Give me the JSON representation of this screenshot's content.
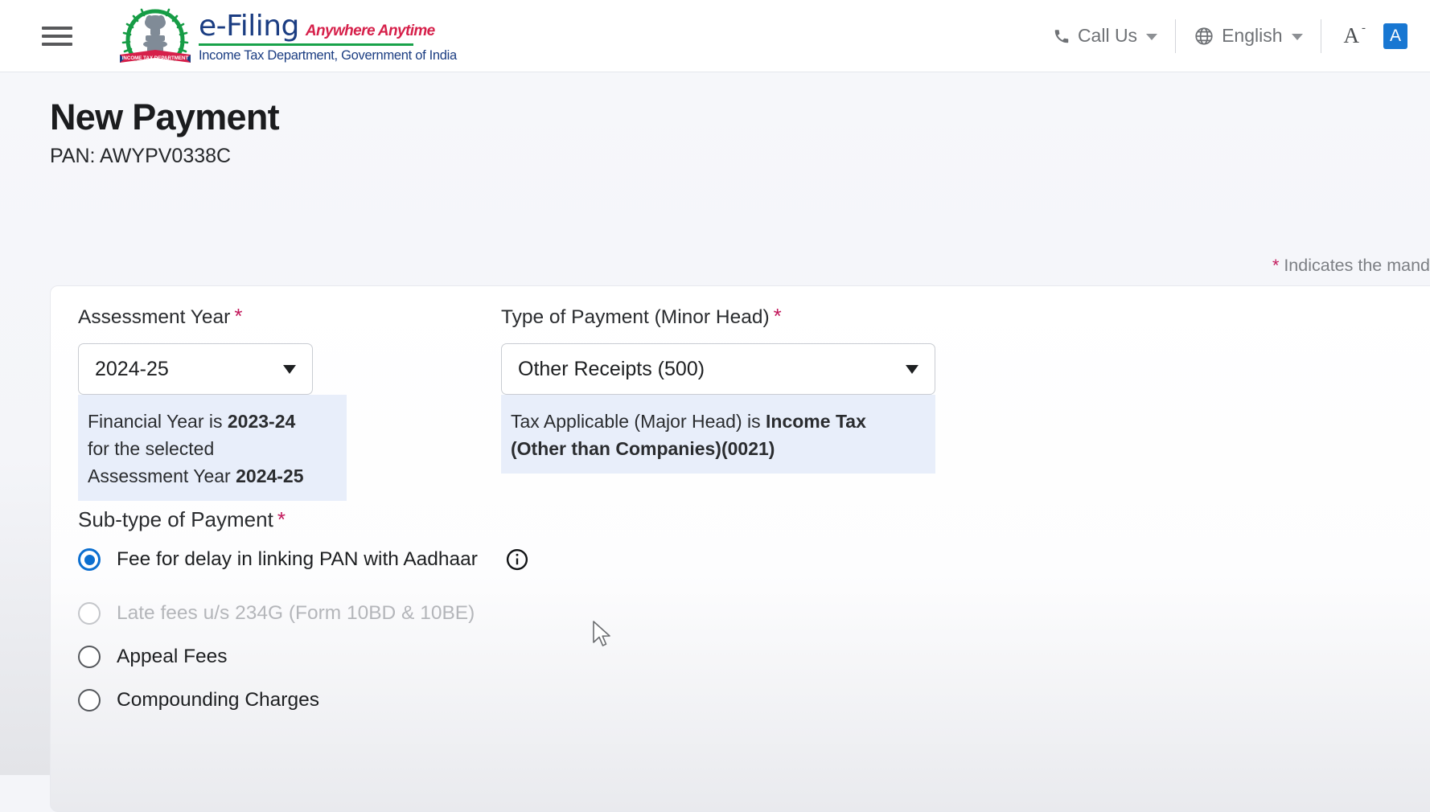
{
  "header": {
    "menu_icon": "hamburger-menu-icon",
    "brand": {
      "emblem": "india-national-emblem-icon",
      "ribbon_text": "INCOME TAX DEPARTMENT",
      "title": "e-Filing",
      "tagline": "Anywhere Anytime",
      "subtitle": "Income Tax Department, Government of India"
    },
    "call_us": {
      "label": "Call Us",
      "icon": "phone-icon"
    },
    "language": {
      "label": "English",
      "icon": "globe-icon"
    },
    "font_size": {
      "label": "A",
      "superscript": "-",
      "icon": "font-size-icon"
    },
    "contrast": {
      "label": "A",
      "icon": "high-contrast-icon",
      "color": "#1877d2"
    }
  },
  "page": {
    "title": "New Payment",
    "pan_line": "PAN: AWYPV0338C",
    "mandatory_note_star": "*",
    "mandatory_note_text": " Indicates the mand"
  },
  "form": {
    "assessment_year": {
      "label": "Assessment Year",
      "required_mark": "*",
      "value": "2024-25",
      "hint_line1_prefix": "Financial Year is ",
      "hint_line1_bold": "2023-24",
      "hint_line2": "for the selected",
      "hint_line3_prefix": "Assessment Year ",
      "hint_line3_bold": "2024-25"
    },
    "type_of_payment": {
      "label": "Type of Payment (Minor Head)",
      "required_mark": "*",
      "value": "Other Receipts (500)",
      "hint_prefix": "Tax Applicable (Major Head) is ",
      "hint_bold_line1": "Income Tax",
      "hint_bold_line2": "(Other than Companies)(0021)"
    },
    "sub_type": {
      "label": "Sub-type of Payment",
      "required_mark": "*",
      "options": [
        {
          "label": "Fee for delay in linking PAN with Aadhaar",
          "selected": true,
          "disabled": false,
          "has_info": true
        },
        {
          "label": "Late fees u/s 234G (Form 10BD & 10BE)",
          "selected": false,
          "disabled": true,
          "has_info": false
        },
        {
          "label": "Appeal Fees",
          "selected": false,
          "disabled": false,
          "has_info": false
        },
        {
          "label": "Compounding Charges",
          "selected": false,
          "disabled": false,
          "has_info": false
        }
      ]
    }
  },
  "colors": {
    "brand_blue": "#1b3d82",
    "brand_red": "#d6204a",
    "brand_green": "#18a24a",
    "required_pink": "#c2185b",
    "accent_blue": "#0c6fd0",
    "hint_bg": "#e8eefa"
  }
}
